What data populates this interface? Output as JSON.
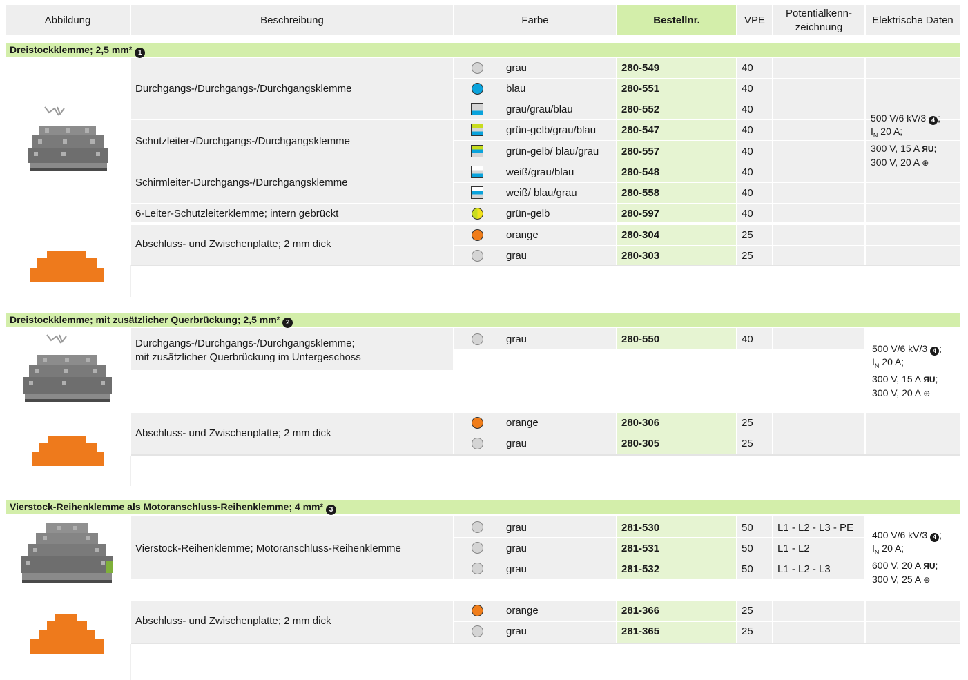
{
  "header": {
    "abbildung": "Abbildung",
    "beschreibung": "Beschreibung",
    "farbe": "Farbe",
    "bestellnr": "Bestellnr.",
    "vpe": "VPE",
    "potential_1": "Potentialkenn-",
    "potential_2": "zeichnung",
    "elektrisch": "Elektrische Daten"
  },
  "sections": [
    {
      "title": "Dreistockklemme; 2,5 mm²",
      "badge": "1",
      "descriptions": [
        "Durchgangs-/Durchgangs-/Durchgangsklemme",
        "Schutzleiter-/Durchgangs-/Durchgangsklemme",
        "Schirmleiter-Durchgangs-/Durchgangsklemme",
        "6-Leiter-Schutzleiterklemme; intern gebrückt",
        "Abschluss- und Zwischenplatte; 2 mm dick"
      ],
      "rows": [
        {
          "color_name": "grau",
          "order": "280-549",
          "vpe": "40",
          "potential": ""
        },
        {
          "color_name": "blau",
          "order": "280-551",
          "vpe": "40",
          "potential": ""
        },
        {
          "color_name": "grau/grau/blau",
          "order": "280-552",
          "vpe": "40",
          "potential": ""
        },
        {
          "color_name": "grün-gelb/grau/blau",
          "order": "280-547",
          "vpe": "40",
          "potential": ""
        },
        {
          "color_name": "grün-gelb/ blau/grau",
          "order": "280-557",
          "vpe": "40",
          "potential": ""
        },
        {
          "color_name": "weiß/grau/blau",
          "order": "280-548",
          "vpe": "40",
          "potential": ""
        },
        {
          "color_name": "weiß/ blau/grau",
          "order": "280-558",
          "vpe": "40",
          "potential": ""
        },
        {
          "color_name": "grün-gelb",
          "order": "280-597",
          "vpe": "40",
          "potential": ""
        },
        {
          "color_name": "orange",
          "order": "280-304",
          "vpe": "25",
          "potential": ""
        },
        {
          "color_name": "grau",
          "order": "280-303",
          "vpe": "25",
          "potential": ""
        }
      ],
      "electrical": {
        "line1": "500 V/6 kV/3",
        "line1_badge": "4",
        "line2_main": "I",
        "line2_sub": "N",
        "line2_rest": " 20 A;",
        "line3": "300 V, 15 A",
        "line4": "300 V, 20 A"
      }
    },
    {
      "title": "Dreistockklemme; mit zusätzlicher Querbrückung; 2,5 mm²",
      "badge": "2",
      "descriptions": [
        "Durchgangs-/Durchgangs-/Durchgangsklemme;",
        "mit zusätzlicher Querbrückung im Untergeschoss",
        "Abschluss- und Zwischenplatte; 2 mm dick"
      ],
      "rows": [
        {
          "color_name": "grau",
          "order": "280-550",
          "vpe": "40",
          "potential": ""
        },
        {
          "color_name": "orange",
          "order": "280-306",
          "vpe": "25",
          "potential": ""
        },
        {
          "color_name": "grau",
          "order": "280-305",
          "vpe": "25",
          "potential": ""
        }
      ],
      "electrical": {
        "line1": "500 V/6 kV/3",
        "line1_badge": "4",
        "line2_main": "I",
        "line2_sub": "N",
        "line2_rest": " 20 A;",
        "line3": "300 V, 15 A",
        "line4": "300 V, 20 A"
      }
    },
    {
      "title": "Vierstock-Reihenklemme als Motoranschluss-Reihenklemme; 4 mm²",
      "badge": "3",
      "descriptions": [
        "Vierstock-Reihenklemme; Motoranschluss-Reihenklemme",
        "Abschluss- und Zwischenplatte; 2 mm dick"
      ],
      "rows": [
        {
          "color_name": "grau",
          "order": "281-530",
          "vpe": "50",
          "potential": "L1 - L2 - L3 - PE"
        },
        {
          "color_name": "grau",
          "order": "281-531",
          "vpe": "50",
          "potential": "L1 - L2"
        },
        {
          "color_name": "grau",
          "order": "281-532",
          "vpe": "50",
          "potential": "L1 - L2 - L3"
        },
        {
          "color_name": "orange",
          "order": "281-366",
          "vpe": "25",
          "potential": ""
        },
        {
          "color_name": "grau",
          "order": "281-365",
          "vpe": "25",
          "potential": ""
        }
      ],
      "electrical": {
        "line1": "400 V/6 kV/3",
        "line1_badge": "4",
        "line2_main": "I",
        "line2_sub": "N",
        "line2_rest": " 20 A;",
        "line3": "600 V, 20 A",
        "line4": "300 V, 25 A"
      }
    }
  ],
  "colors": {
    "band": "#d3eeaa",
    "order_cell": "#e6f4d2",
    "grey_cell": "#efefef",
    "swatch_grey": "#d4d4d4",
    "swatch_blue": "#0aa3dc",
    "swatch_orange": "#f07d1a",
    "swatch_yellowgreen": "#c8dc1e"
  }
}
